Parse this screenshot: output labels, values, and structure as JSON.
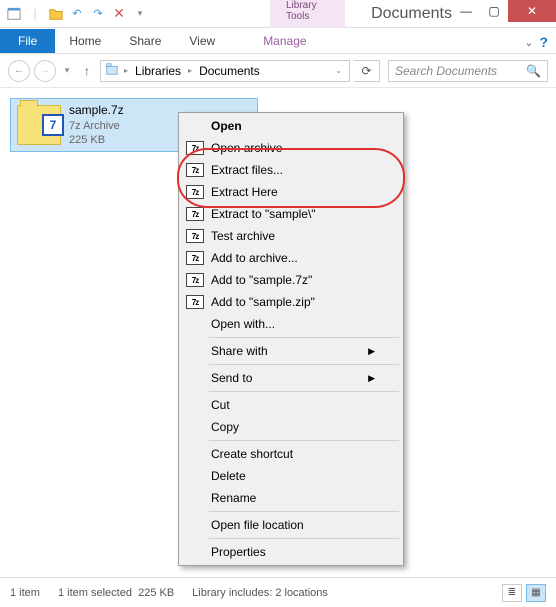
{
  "titlebar": {
    "library_tools": "Library Tools",
    "title": "Documents"
  },
  "ribbon": {
    "file": "File",
    "home": "Home",
    "share": "Share",
    "view": "View",
    "manage": "Manage"
  },
  "addressbar": {
    "libraries": "Libraries",
    "documents": "Documents",
    "search_placeholder": "Search Documents"
  },
  "file": {
    "name": "sample.7z",
    "type": "7z Archive",
    "size": "225 KB",
    "badge": "7"
  },
  "context_menu": {
    "open": "Open",
    "open_archive": "Open archive",
    "extract_files": "Extract files...",
    "extract_here": "Extract Here",
    "extract_to": "Extract to \"sample\\\"",
    "test_archive": "Test archive",
    "add_to_archive": "Add to archive...",
    "add_to_7z": "Add to \"sample.7z\"",
    "add_to_zip": "Add to \"sample.zip\"",
    "open_with": "Open with...",
    "share_with": "Share with",
    "send_to": "Send to",
    "cut": "Cut",
    "copy": "Copy",
    "create_shortcut": "Create shortcut",
    "delete": "Delete",
    "rename": "Rename",
    "open_file_location": "Open file location",
    "properties": "Properties",
    "icon_7z": "7z"
  },
  "status": {
    "count": "1 item",
    "selected": "1 item selected",
    "sel_size": "225 KB",
    "library_includes": "Library includes: 2 locations"
  }
}
